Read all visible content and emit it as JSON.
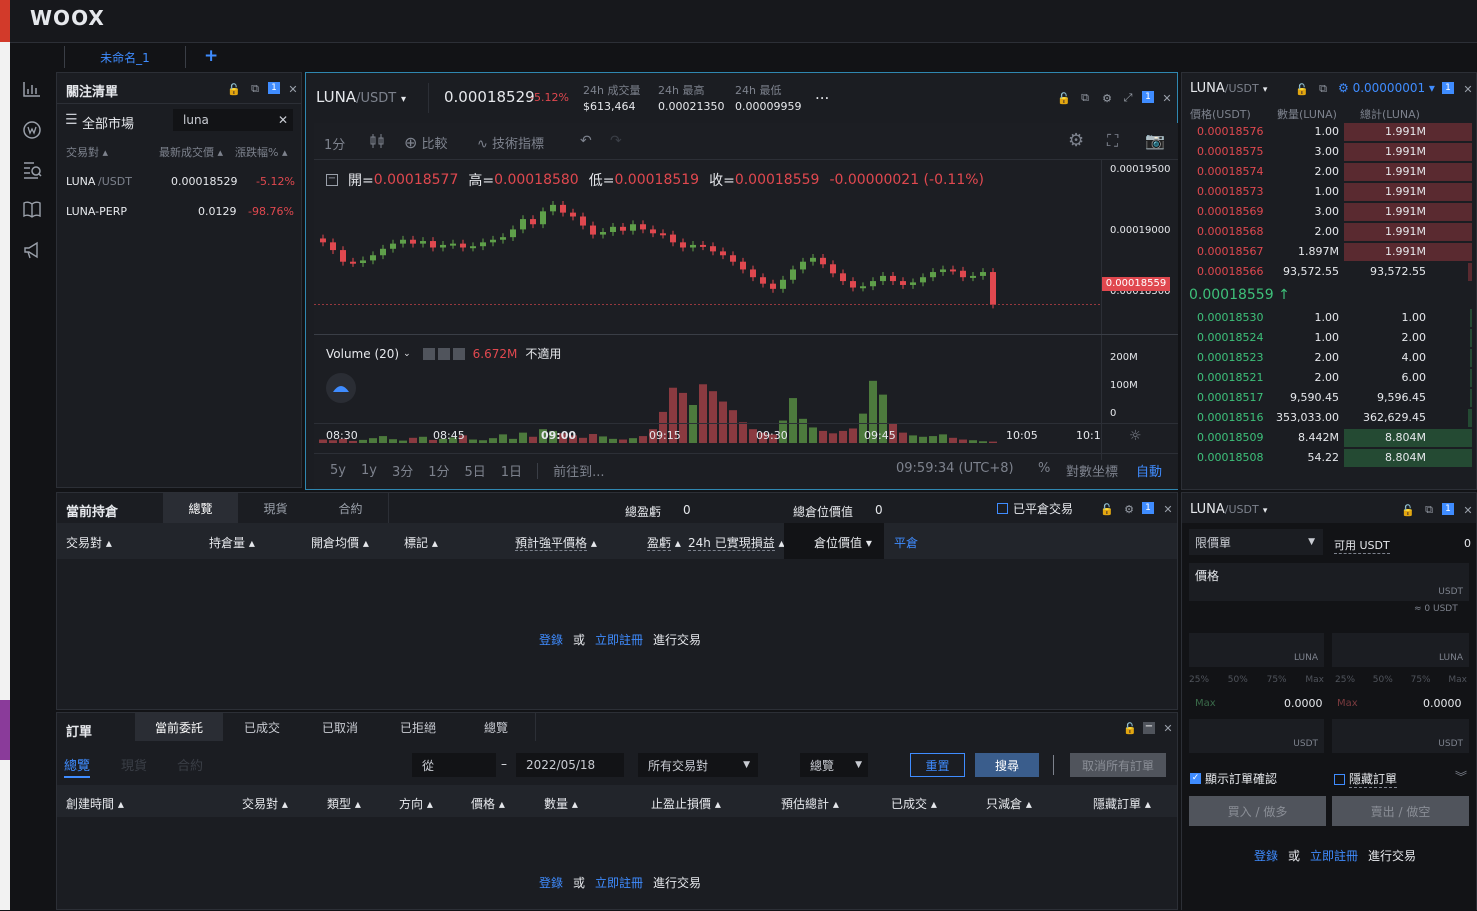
{
  "brand": "WOOX",
  "workspace": {
    "tab": "未命名_1",
    "add": "+"
  },
  "watchlist": {
    "title": "關注清單",
    "all_markets": "全部市場",
    "search_value": "luna",
    "clear": "✕",
    "cols": [
      "交易對",
      "最新成交價",
      "漲跌幅%"
    ],
    "rows": [
      {
        "sym": "LUNA",
        "quote": "/USDT",
        "price": "0.00018529",
        "chg": "-5.12%"
      },
      {
        "sym": "LUNA-PERP",
        "quote": "",
        "price": "0.0129",
        "chg": "-98.76%"
      }
    ]
  },
  "chart": {
    "symbol": "LUNA",
    "quote": "/USDT",
    "price": "0.00018529",
    "change": "-5.12%",
    "vol_label": "24h 成交量",
    "vol_value": "$613,464",
    "high_label": "24h 最高",
    "high_value": "0.00021350",
    "low_label": "24h 最低",
    "low_value": "0.00009959",
    "more": "...",
    "toolbar": {
      "interval": "1分",
      "compare": "比較",
      "indicators": "技術指標"
    },
    "ohlc": {
      "o_label": "開=",
      "o": "0.00018577",
      "h_label": "高=",
      "h": "0.00018580",
      "l_label": "低=",
      "l": "0.00018519",
      "c_label": "收=",
      "c": "0.00018559",
      "diff": "-0.00000021 (-0.11%)"
    },
    "yticks": [
      "0.00019500",
      "0.00019000",
      "0.00018500"
    ],
    "last_tag": "0.00018559",
    "volume_label": "Volume (20)",
    "volume_value": "6.672M",
    "volume_na": "不適用",
    "vticks": [
      "200M",
      "100M",
      "0"
    ],
    "xticks": [
      "08:30",
      "08:45",
      "09:00",
      "09:15",
      "09:30",
      "09:45",
      "10:05",
      "10:1"
    ],
    "ranges": [
      "5y",
      "1y",
      "3分",
      "1分",
      "5日",
      "1日"
    ],
    "goto": "前往到...",
    "clock": "09:59:34 (UTC+8)",
    "pct": "%",
    "log": "對數坐標",
    "auto": "自動"
  },
  "chart_data": {
    "type": "candlestick",
    "ylim": [
      0.000184,
      0.000196
    ],
    "closes": [
      0.0001904,
      0.0001898,
      0.0001889,
      0.0001888,
      0.000189,
      0.0001894,
      0.0001899,
      0.0001903,
      0.0001906,
      0.0001903,
      0.0001905,
      0.00019,
      0.0001902,
      0.0001903,
      0.00019,
      0.0001901,
      0.0001904,
      0.0001906,
      0.0001908,
      0.0001914,
      0.0001922,
      0.0001918,
      0.0001928,
      0.0001933,
      0.0001927,
      0.0001924,
      0.0001917,
      0.000191,
      0.0001912,
      0.0001916,
      0.0001913,
      0.0001918,
      0.0001914,
      0.0001911,
      0.000191,
      0.0001904,
      0.00019,
      0.0001902,
      0.0001901,
      0.0001897,
      0.0001894,
      0.0001889,
      0.0001883,
      0.0001877,
      0.0001872,
      0.0001868,
      0.0001875,
      0.0001883,
      0.0001889,
      0.0001892,
      0.0001887,
      0.000188,
      0.0001874,
      0.0001869,
      0.000187,
      0.0001874,
      0.0001878,
      0.0001874,
      0.0001871,
      0.0001873,
      0.0001877,
      0.0001881,
      0.0001883,
      0.0001882,
      0.0001877,
      0.0001878,
      0.0001881,
      0.00018559
    ],
    "volumes_m": [
      10,
      8,
      12,
      6,
      9,
      14,
      20,
      11,
      7,
      15,
      18,
      9,
      12,
      16,
      22,
      10,
      8,
      14,
      25,
      12,
      30,
      18,
      40,
      35,
      28,
      22,
      15,
      26,
      19,
      12,
      10,
      14,
      20,
      40,
      90,
      160,
      145,
      110,
      170,
      150,
      120,
      95,
      60,
      40,
      30,
      25,
      65,
      130,
      70,
      45,
      35,
      28,
      35,
      42,
      85,
      180,
      140,
      55,
      30,
      22,
      18,
      20,
      25,
      15,
      10,
      8,
      5,
      4
    ]
  },
  "orderbook": {
    "symbol": "LUNA",
    "quote": "/USDT",
    "tick": "0.00000001",
    "cols": [
      "價格(USDT)",
      "數量(LUNA)",
      "總計(LUNA)"
    ],
    "asks": [
      {
        "p": "0.00018576",
        "q": "1.00",
        "t": "1.991M"
      },
      {
        "p": "0.00018575",
        "q": "3.00",
        "t": "1.991M"
      },
      {
        "p": "0.00018574",
        "q": "2.00",
        "t": "1.991M"
      },
      {
        "p": "0.00018573",
        "q": "1.00",
        "t": "1.991M"
      },
      {
        "p": "0.00018569",
        "q": "3.00",
        "t": "1.991M"
      },
      {
        "p": "0.00018568",
        "q": "2.00",
        "t": "1.991M"
      },
      {
        "p": "0.00018567",
        "q": "1.897M",
        "t": "1.991M"
      },
      {
        "p": "0.00018566",
        "q": "93,572.55",
        "t": "93,572.55"
      }
    ],
    "mid": "0.00018559 ↑",
    "bids": [
      {
        "p": "0.00018530",
        "q": "1.00",
        "t": "1.00"
      },
      {
        "p": "0.00018524",
        "q": "1.00",
        "t": "2.00"
      },
      {
        "p": "0.00018523",
        "q": "2.00",
        "t": "4.00"
      },
      {
        "p": "0.00018521",
        "q": "2.00",
        "t": "6.00"
      },
      {
        "p": "0.00018517",
        "q": "9,590.45",
        "t": "9,596.45"
      },
      {
        "p": "0.00018516",
        "q": "353,033.00",
        "t": "362,629.45"
      },
      {
        "p": "0.00018509",
        "q": "8.442M",
        "t": "8.804M"
      },
      {
        "p": "0.00018508",
        "q": "54.22",
        "t": "8.804M"
      }
    ]
  },
  "positions": {
    "title": "當前持倉",
    "tabs": [
      "總覽",
      "現貨",
      "合約"
    ],
    "pnl_label": "總盈虧",
    "pnl": "0",
    "value_label": "總倉位價值",
    "value": "0",
    "closed": "已平倉交易",
    "cols": [
      "交易對",
      "持倉量",
      "開倉均價",
      "標記",
      "預計強平價格",
      "盈虧",
      "24h 已實現損益",
      "倉位價值",
      "平倉"
    ],
    "login": "登錄",
    "or": "或",
    "register": "立即註冊",
    "trade": "進行交易"
  },
  "orders": {
    "title": "訂單",
    "tabs": [
      "當前委託",
      "已成交",
      "已取消",
      "已拒絕",
      "總覽"
    ],
    "subtabs": [
      "總覽",
      "現貨",
      "合約"
    ],
    "from": "從",
    "dash": "–",
    "date": "2022/05/18",
    "pair": "所有交易對",
    "view": "總覽",
    "reset": "重置",
    "search": "搜尋",
    "cancel_all": "取消所有訂單",
    "cols": [
      "創建時間",
      "交易對",
      "類型",
      "方向",
      "價格",
      "數量",
      "止盈止損價",
      "預估總計",
      "已成交",
      "只減倉",
      "隱藏訂單"
    ],
    "login": "登錄",
    "or": "或",
    "register": "立即註冊",
    "trade": "進行交易"
  },
  "trade": {
    "symbol": "LUNA",
    "quote": "/USDT",
    "order_type": "限價單",
    "avail_label": "可用 USDT",
    "avail": "0",
    "price_label": "價格",
    "usdt": "USDT",
    "approx": "≈ 0  USDT",
    "luna": "LUNA",
    "pcts": [
      "25%",
      "50%",
      "75%",
      "Max"
    ],
    "max_label": "Max",
    "max_val": "0.0000",
    "confirm": "顯示訂單確認",
    "hidden": "隱藏訂單",
    "buy": "買入 / 做多",
    "sell": "賣出 / 做空",
    "login": "登錄",
    "or": "或",
    "register": "立即註冊",
    "trade": "進行交易"
  }
}
